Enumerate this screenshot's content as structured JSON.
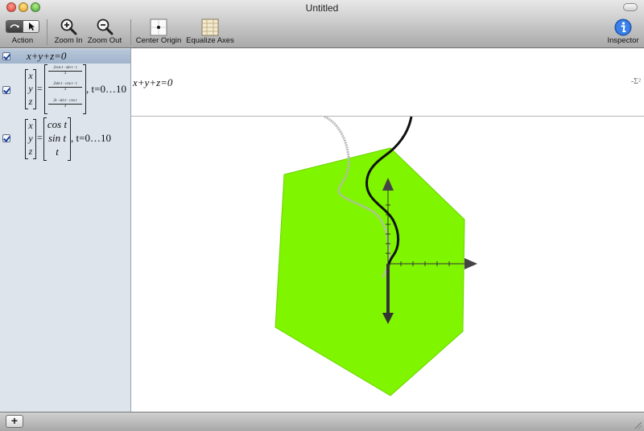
{
  "window": {
    "title": "Untitled"
  },
  "toolbar": {
    "action_label": "Action",
    "zoom_in_label": "Zoom In",
    "zoom_out_label": "Zoom Out",
    "center_origin_label": "Center Origin",
    "equalize_axes_label": "Equalize Axes",
    "inspector_label": "Inspector"
  },
  "sidebar": {
    "equations": [
      {
        "text": "x+y+z=0",
        "selected": true,
        "checked": true
      },
      {
        "vector": [
          "x",
          "y",
          "z"
        ],
        "components": [
          {
            "num": "2cos t · sin t · t",
            "den": "3"
          },
          {
            "num": "2sin t · cos t · t",
            "den": "3"
          },
          {
            "num": "2t · sin t · cos t",
            "den": "3"
          }
        ],
        "range": ", t=0…10",
        "checked": true
      },
      {
        "vector": [
          "x",
          "y",
          "z"
        ],
        "components": [
          "cos t",
          "sin t",
          "t"
        ],
        "range": ", t=0…10",
        "checked": true
      }
    ]
  },
  "editor": {
    "text": "x+y+z=0",
    "sigma": "-Σ²"
  },
  "graph": {
    "plane_color": "#7ff500",
    "curve_color": "#111111",
    "ghost_curve_color": "#b0b0b0",
    "axis_color": "#333333"
  },
  "bottom_bar": {
    "add_label": "+"
  }
}
